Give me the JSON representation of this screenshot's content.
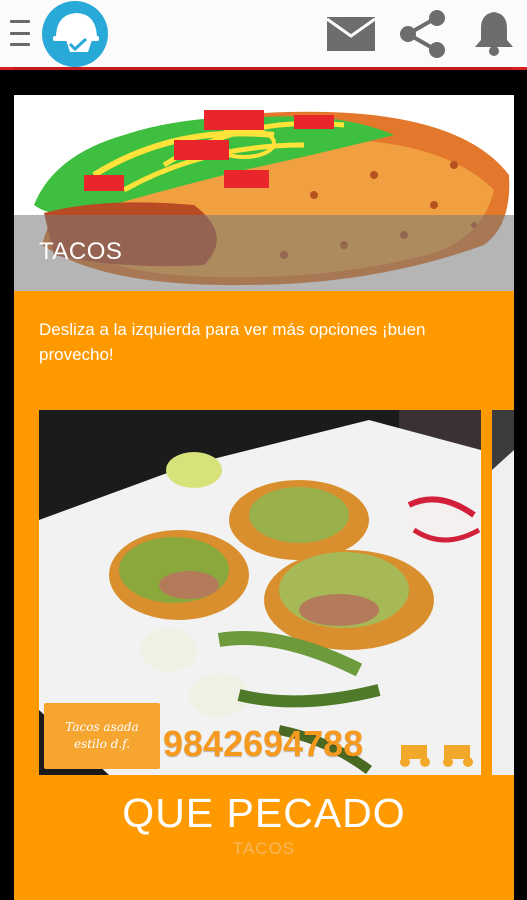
{
  "topbar": {
    "menu_icon": "hamburger-menu-icon",
    "logo_icon": "delivery-helmet-logo-icon",
    "actions": [
      {
        "name": "mail-icon"
      },
      {
        "name": "share-icon"
      },
      {
        "name": "bell-icon"
      }
    ],
    "accent_color": "#d81e1e"
  },
  "card": {
    "hero_title": "TACOS",
    "instruction": "Desliza a la izquierda para ver más opciones ¡buen provecho!",
    "photo_caption_line1": "Tacos asada",
    "photo_caption_line2": "estilo d.f.",
    "photo_phone": "9842694788",
    "restaurant_name": "QUE PECADO",
    "category": "TACOS",
    "background_color": "#ff9900"
  }
}
